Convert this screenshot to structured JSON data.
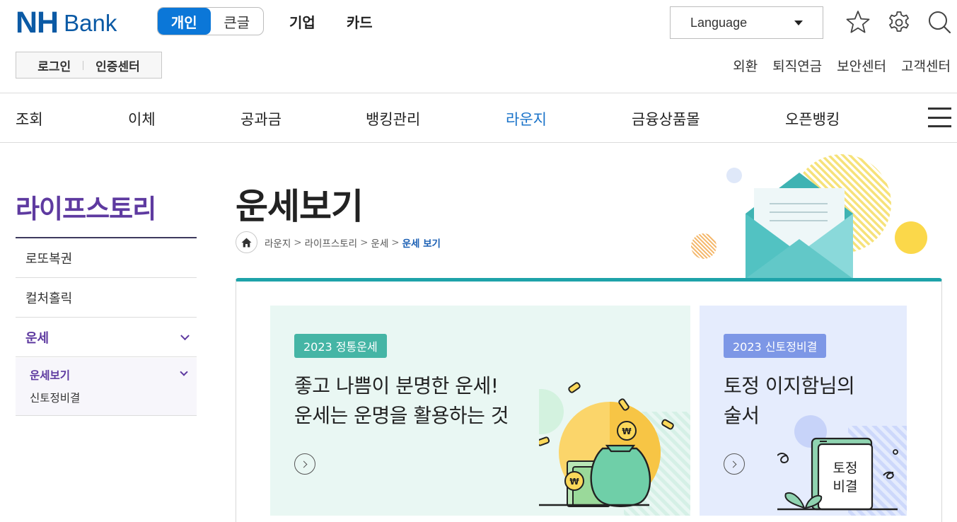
{
  "brand": {
    "nh": "NH",
    "bank": "Bank",
    "color": "#0b5aa5"
  },
  "mode_switch": {
    "personal": "개인",
    "large": "큰글"
  },
  "top_links": [
    "기업",
    "카드"
  ],
  "language": {
    "label": "Language"
  },
  "header_icons": [
    "star-icon",
    "gear-icon",
    "search-icon"
  ],
  "auth": {
    "login": "로그인",
    "cert": "인증센터"
  },
  "util_links": [
    "외환",
    "퇴직연금",
    "보안센터",
    "고객센터"
  ],
  "gnb": {
    "items": [
      "조회",
      "이체",
      "공과금",
      "뱅킹관리",
      "라운지",
      "금융상품몰",
      "오픈뱅킹"
    ],
    "active": "라운지",
    "active_color": "#1a73c9"
  },
  "lnb": {
    "title": "라이프스토리",
    "items": [
      "로또복권",
      "컬처홀릭",
      "운세"
    ],
    "sub_items": [
      "운세보기",
      "신토정비결"
    ],
    "accent": "#5e3aa0"
  },
  "page": {
    "title": "운세보기",
    "breadcrumb": [
      "라운지",
      "라이프스토리",
      "운세",
      "운세 보기"
    ]
  },
  "cards": [
    {
      "badge": "2023 정통운세",
      "line1": "좋고 나쁨이 분명한 운세!",
      "line2": "운세는 운명을 활용하는 것"
    },
    {
      "badge": "2023 신토정비결",
      "line1": "토정 이지함님의",
      "line2": "술서",
      "book_line1": "토정",
      "book_line2": "비결"
    }
  ]
}
